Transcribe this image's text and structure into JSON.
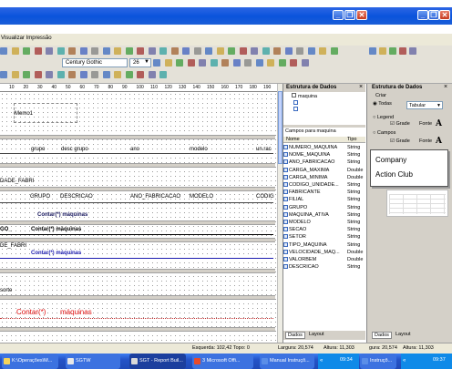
{
  "menu": {
    "item": "Visualizar Impressão"
  },
  "toolbar": {
    "font": "Century Gothic",
    "size": "26"
  },
  "ruler": {
    "labels": [
      "10",
      "20",
      "30",
      "40",
      "50",
      "60",
      "70",
      "80",
      "90",
      "100",
      "110",
      "120",
      "130",
      "140",
      "150",
      "160",
      "170",
      "180",
      "190"
    ]
  },
  "report": {
    "memo": "Memo1",
    "header_cols": [
      "grupo",
      "desc grupo",
      "ano",
      "modelo",
      "un.rac"
    ],
    "group_field": "DADE_FABRI",
    "cols2": [
      "GRUPO",
      "DESCRICAO",
      "ANO_FABRICACAO",
      "MODELO",
      "CODIG"
    ],
    "count1": "Contar(*) máquinas",
    "group_frag": "GO_",
    "count2": "Contar(*) máquinas",
    "group2": "DE_FABRI",
    "count3": "Contar(*) máquinas",
    "footer_frag": "sorte",
    "big_count_a": "Contar(*)",
    "big_count_b": "máquinas"
  },
  "data_panel": {
    "title": "Estrutura de Dados",
    "tree_item": "maquina",
    "fields_label": "Campos para maquina",
    "col_name": "Nome",
    "col_type": "Tipo",
    "fields": [
      {
        "name": "NUMERO_MAQUINA",
        "type": "String"
      },
      {
        "name": "NOME_MAQUINA",
        "type": "String"
      },
      {
        "name": "ANO_FABRICACAO",
        "type": "String"
      },
      {
        "name": "CARGA_MAXIMA",
        "type": "Double"
      },
      {
        "name": "CARGA_MINIMA",
        "type": "Double"
      },
      {
        "name": "CODIGO_UNIDADE...",
        "type": "String"
      },
      {
        "name": "FABRICANTE",
        "type": "String"
      },
      {
        "name": "FILIAL",
        "type": "String"
      },
      {
        "name": "GRUPO",
        "type": "String"
      },
      {
        "name": "MAQUINA_ATIVA",
        "type": "String"
      },
      {
        "name": "MODELO",
        "type": "String"
      },
      {
        "name": "SECAO",
        "type": "String"
      },
      {
        "name": "SETOR",
        "type": "String"
      },
      {
        "name": "TIPO_MAQUINA",
        "type": "String"
      },
      {
        "name": "VELOCIDADE_MAQ...",
        "type": "Double"
      },
      {
        "name": "VALORBEM",
        "type": "Double"
      },
      {
        "name": "DESCRICAO",
        "type": "String"
      }
    ],
    "tabs": [
      "Dados",
      "Layout"
    ]
  },
  "right_panel": {
    "title": "Estrutura de Dados",
    "criar": "Criar",
    "todas": "Todas",
    "tabular": "Tabular",
    "legend": "Legend",
    "grade": "Grade",
    "fonte": "Fonte",
    "campos": "Campos",
    "grade2": "Grade",
    "fonte2": "Fonte",
    "company": "Company",
    "action": "Action Club",
    "tabs": [
      "Dados",
      "Layout"
    ]
  },
  "status": {
    "pos": "Esquerda: 102,42 Topo: 0",
    "width": "Largura: 20,574",
    "height": "Altura: 11,303",
    "width2": "gura: 20,574",
    "height2": "Altura: 11,303"
  },
  "taskbar": {
    "items": [
      "K:\\Operações\\M...",
      "SGTW",
      "SGT - Report Buil...",
      "3 Microsoft Offi...",
      "Manual Instruçõ...",
      "Instruçõ..."
    ],
    "time1": "09:34",
    "time2": "09:37"
  },
  "colors": {
    "taskbar": "#2453c7",
    "accent_blue": "#1c1cb0",
    "red_text": "#e01010",
    "titlebar": "#0a58e0"
  }
}
